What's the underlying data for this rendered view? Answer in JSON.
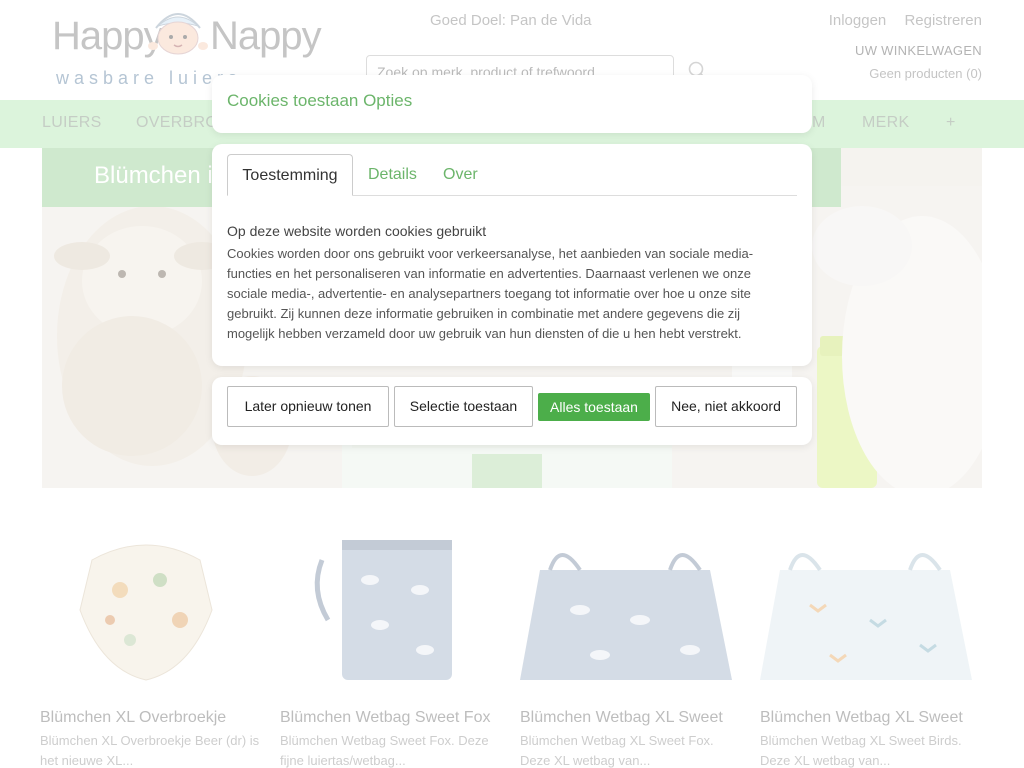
{
  "header": {
    "logo_word_1": "Happy",
    "logo_word_2": "Nappy",
    "logo_tagline": "wasbare luiers",
    "goal_text": "Goed Doel: Pan de Vida",
    "login": "Inloggen",
    "register": "Registreren",
    "cart_title": "UW WINKELWAGEN",
    "cart_status": "Geen producten (0)",
    "search_placeholder": "Zoek op merk, product of trefwoord..."
  },
  "nav": {
    "items": [
      "LUIERS",
      "OVERBRO",
      "M",
      "MERK",
      "+"
    ]
  },
  "hero": {
    "title": "Blümchen i"
  },
  "products": [
    {
      "title": "Blümchen XL Overbroekje",
      "desc": "Blümchen XL Overbroekje Beer (dr) is het nieuwe XL..."
    },
    {
      "title": "Blümchen Wetbag Sweet Fox",
      "desc": "Blümchen Wetbag Sweet Fox. Deze fijne luiertas/wetbag..."
    },
    {
      "title": "Blümchen Wetbag XL Sweet",
      "desc": "Blümchen Wetbag XL Sweet Fox. Deze XL wetbag van..."
    },
    {
      "title": "Blümchen Wetbag XL Sweet",
      "desc": "Blümchen Wetbag XL Sweet Birds. Deze XL wetbag van..."
    }
  ],
  "cookie_dialog": {
    "title": "Cookies toestaan Opties",
    "tabs": [
      "Toestemming",
      "Details",
      "Over"
    ],
    "heading": "Op deze website worden cookies gebruikt",
    "text": "Cookies worden door ons gebruikt voor verkeersanalyse, het aanbieden van sociale media-functies en het personaliseren van informatie en advertenties. Daarnaast verlenen we onze sociale media-, advertentie- en analysepartners toegang tot informatie over hoe u onze site gebruikt. Zij kunnen deze informatie gebruiken in combinatie met andere gegevens die zij mogelijk hebben verzameld door uw gebruik van hun diensten of die u hen hebt verstrekt.",
    "buttons": {
      "later": "Later opnieuw tonen",
      "selection": "Selectie toestaan",
      "allow_all": "Alles toestaan",
      "deny": "Nee, niet akkoord"
    }
  },
  "colors": {
    "nav_bg": "#b9e8b8",
    "accent_green": "#6cb56b",
    "primary_button": "#4cae4a"
  }
}
